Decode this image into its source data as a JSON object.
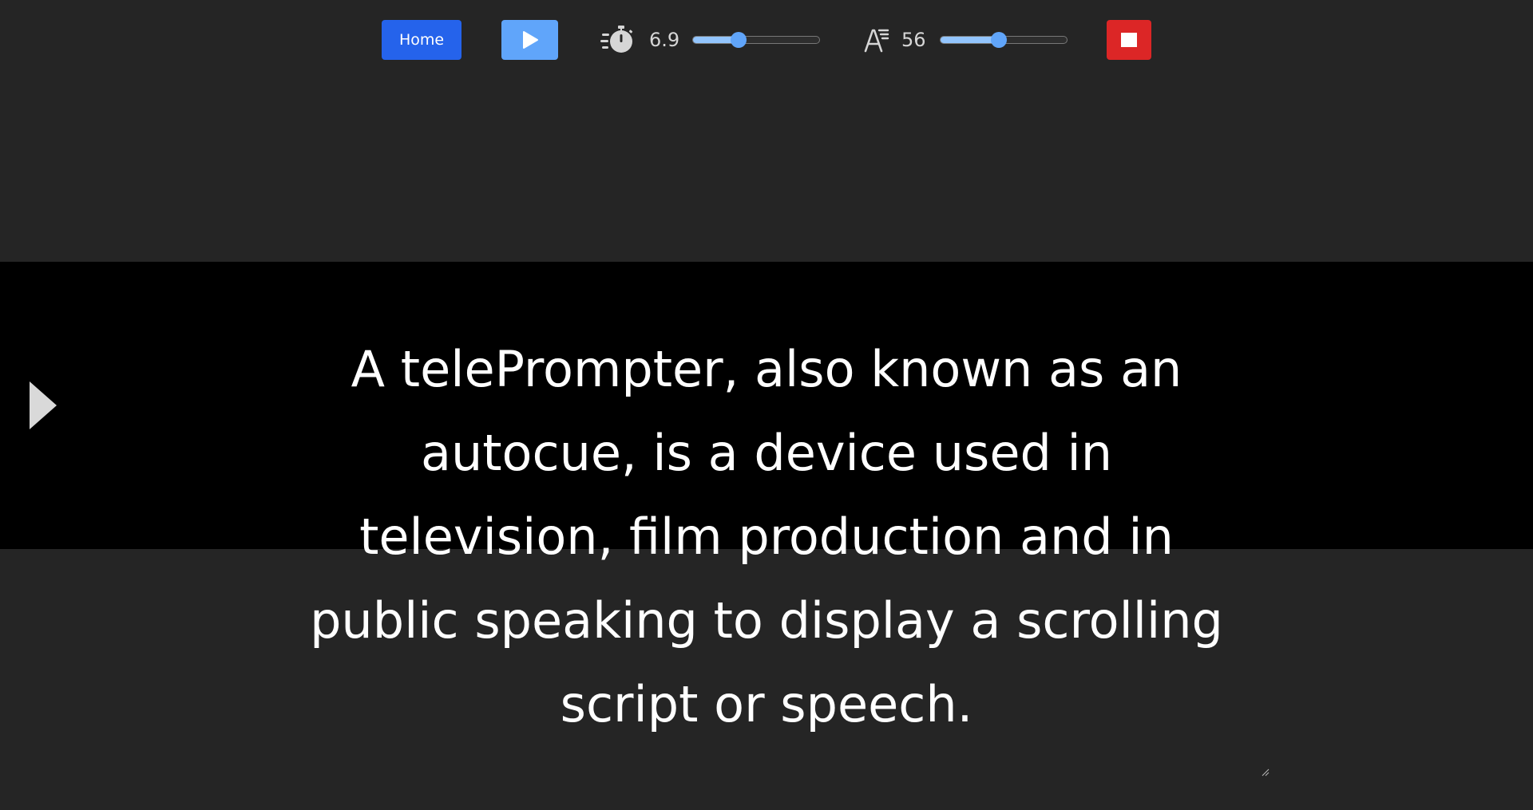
{
  "toolbar": {
    "home_label": "Home",
    "play_icon": "play-icon",
    "speed": {
      "icon": "stopwatch-speed-icon",
      "value": "6.9",
      "level_fraction": 0.36
    },
    "font_size": {
      "icon": "font-size-icon",
      "value": "56",
      "level_fraction": 0.46
    },
    "stop_icon": "stop-icon"
  },
  "marker": {
    "icon": "position-marker-triangle-icon"
  },
  "script": {
    "text": "A telePrompter, also known as an autocue, is a device used in television, film production and in public speaking to display a scrolling script or speech."
  },
  "colors": {
    "background": "#252525",
    "reading_band": "#000000",
    "home_button": "#2563eb",
    "play_button": "#60a5fa",
    "slider_fill": "#93c5fd",
    "stop_button": "#dc2626",
    "text": "#ffffff"
  }
}
